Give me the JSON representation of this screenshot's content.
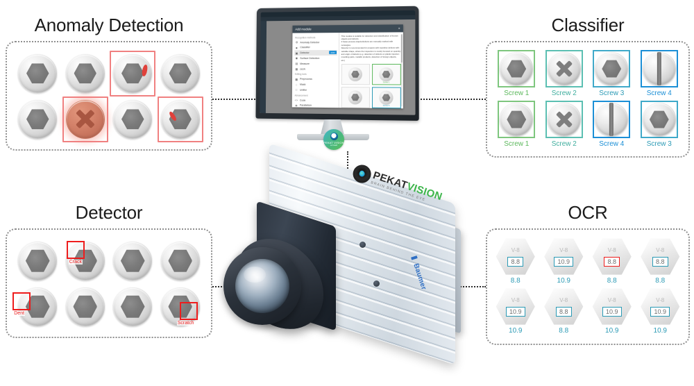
{
  "page": {
    "background": "#ffffff",
    "accent_green": "#5cb85c",
    "accent_teal": "#2b9ab5",
    "accent_blue": "#1b8fd6",
    "accent_red": "#ee1c1c",
    "accent_soft_red": "#f08080"
  },
  "quadrants": {
    "anomaly": {
      "title": "Anomaly Detection",
      "items": [
        {
          "type": "hex",
          "flagged": false,
          "defect": "none"
        },
        {
          "type": "hex",
          "flagged": false,
          "defect": "none"
        },
        {
          "type": "hex",
          "flagged": true,
          "defect": "chip-right"
        },
        {
          "type": "hex",
          "flagged": false,
          "defect": "none"
        },
        {
          "type": "hex",
          "flagged": false,
          "defect": "none"
        },
        {
          "type": "cross",
          "flagged": true,
          "defect": "wrong-part"
        },
        {
          "type": "hex",
          "flagged": false,
          "defect": "none"
        },
        {
          "type": "hex",
          "flagged": true,
          "defect": "chip-left"
        }
      ]
    },
    "classifier": {
      "title": "Classifier",
      "items": [
        {
          "label": "Screw 1",
          "head": "hex",
          "color": "#5cb85c"
        },
        {
          "label": "Screw 2",
          "head": "cross",
          "color": "#3fae9e"
        },
        {
          "label": "Screw 3",
          "head": "hex",
          "color": "#2b9ab5"
        },
        {
          "label": "Screw 4",
          "head": "slot",
          "color": "#1b8fd6"
        },
        {
          "label": "Screw 1",
          "head": "hex",
          "color": "#5cb85c"
        },
        {
          "label": "Screw 2",
          "head": "cross",
          "color": "#3fae9e"
        },
        {
          "label": "Screw 4",
          "head": "slot",
          "color": "#1b8fd6"
        },
        {
          "label": "Screw 3",
          "head": "hex",
          "color": "#2b9ab5"
        }
      ]
    },
    "detector": {
      "title": "Detector",
      "items": [
        {
          "defect": null,
          "box": null
        },
        {
          "defect": "Crack",
          "box": "top-left"
        },
        {
          "defect": null,
          "box": null
        },
        {
          "defect": null,
          "box": null
        },
        {
          "defect": "Dent",
          "box": "left"
        },
        {
          "defect": null,
          "box": null
        },
        {
          "defect": null,
          "box": null
        },
        {
          "defect": "Scratch",
          "box": "bottom-right"
        }
      ]
    },
    "ocr": {
      "title": "OCR",
      "items": [
        {
          "top": "V-8",
          "grade": "8.8",
          "read": "8.8",
          "error": false
        },
        {
          "top": "V-8",
          "grade": "10.9",
          "read": "10.9",
          "error": false
        },
        {
          "top": "V-8",
          "grade": "8.8",
          "read": "8.8",
          "error": true
        },
        {
          "top": "V-8",
          "grade": "8.8",
          "read": "8.8",
          "error": false
        },
        {
          "top": "V-8",
          "grade": "10.9",
          "read": "10.9",
          "error": false
        },
        {
          "top": "V-8",
          "grade": "8.8",
          "read": "8.8",
          "error": false
        },
        {
          "top": "V-8",
          "grade": "10.9",
          "read": "10.9",
          "error": false
        },
        {
          "top": "V-8",
          "grade": "10.9",
          "read": "10.9",
          "error": false
        }
      ]
    }
  },
  "monitor": {
    "modal": {
      "title": "Add module",
      "close": "×",
      "menu_sections": [
        {
          "heading": "Recognition methods",
          "items": [
            {
              "label": "Anomaly Detector",
              "icon": "target-icon",
              "active": false,
              "badge": null
            },
            {
              "label": "Classifier",
              "icon": "tag-icon",
              "active": false,
              "badge": null
            },
            {
              "label": "Detector",
              "icon": "frame-icon",
              "active": true,
              "badge": "ADD"
            },
            {
              "label": "Surface Detection",
              "icon": "surface-icon",
              "active": false,
              "badge": null
            },
            {
              "label": "Measure",
              "icon": "ruler-icon",
              "active": false,
              "badge": null
            },
            {
              "label": "OCR",
              "icon": "text-icon",
              "active": false,
              "badge": null
            }
          ]
        },
        {
          "heading": "Editing tools",
          "items": [
            {
              "label": "Preprocess",
              "icon": "filter-icon",
              "active": false,
              "badge": null
            },
            {
              "label": "Mask",
              "icon": "mask-icon",
              "active": false,
              "badge": null
            },
            {
              "label": "Unifier",
              "icon": "layers-icon",
              "active": false,
              "badge": null
            }
          ]
        },
        {
          "heading": "Advancement",
          "items": [
            {
              "label": "Code",
              "icon": "code-icon",
              "active": false,
              "badge": null
            },
            {
              "label": "Parallelism",
              "icon": "branch-icon",
              "active": false,
              "badge": null
            }
          ]
        }
      ],
      "description": [
        "This module is suitable for detection and classification of known objects and defects.",
        "It helps process objects/defects are manually marked with rectangles.",
        "Detector is recommended for projects with repetitive defects with variable shape, where the inspection is mostly focused on quantity and origin of defects (e.g. detection of defects on plastic injection moulding parts, metallic products, detection of foreign objects, etc.)"
      ],
      "thumbs": [
        {
          "selected": false,
          "color": null,
          "label": ""
        },
        {
          "selected": true,
          "color": "#5cb85c",
          "label": "Screw 1"
        },
        {
          "selected": false,
          "color": null,
          "label": ""
        },
        {
          "selected": true,
          "color": "#2b9ab5",
          "label": "Screw 3"
        }
      ]
    },
    "logo": {
      "name": "PEKAT VISION",
      "tagline": "on board"
    }
  },
  "camera": {
    "brand_mark": "pekat-eye-logo",
    "logo_pekat": "PEKAT",
    "logo_vision": "VISION",
    "logo_tagline": "BRAIN BEHIND THE EYE",
    "manufacturer": "Baumer"
  },
  "connectors": {
    "anomaly_to_monitor": "dotted",
    "monitor_to_classifier": "dotted",
    "detector_to_camera": "dotted",
    "camera_to_ocr": "dotted",
    "monitor_to_camera": "dotted-vertical"
  }
}
